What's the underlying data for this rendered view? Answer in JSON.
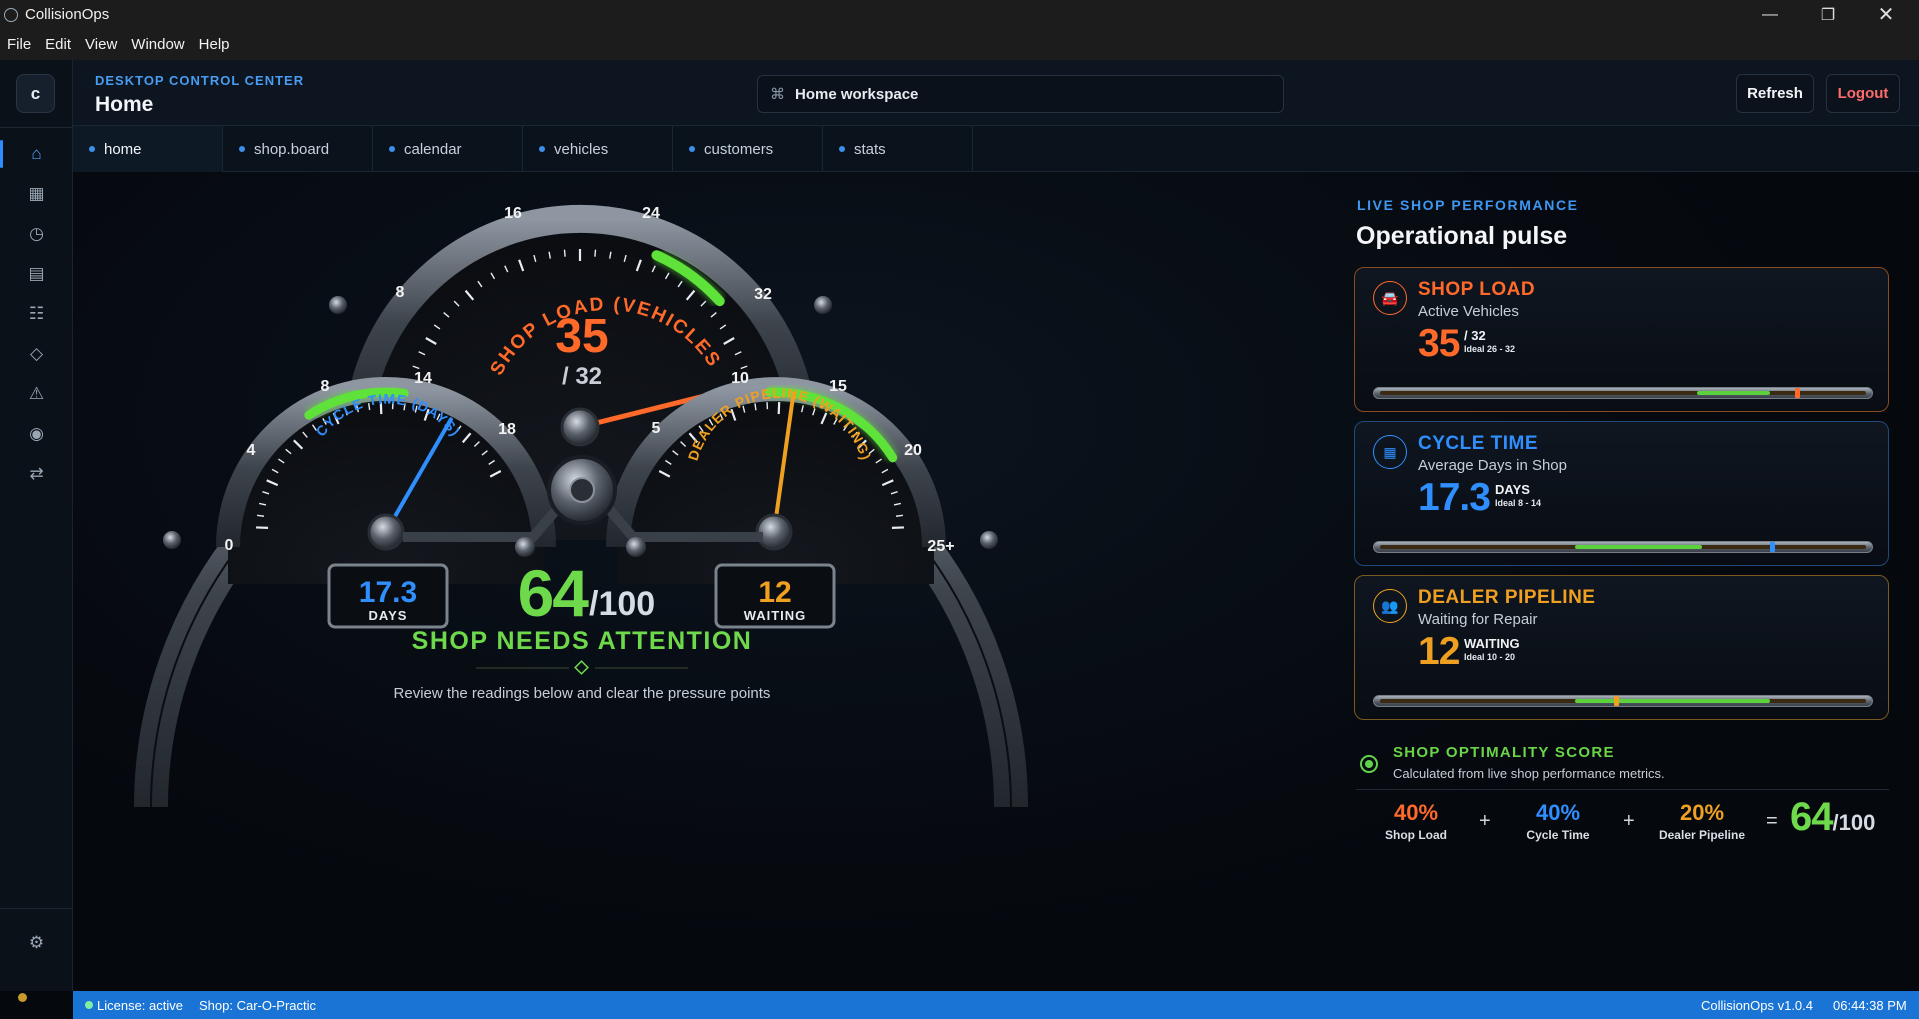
{
  "window": {
    "title": "CollisionOps",
    "controls": {
      "minimize": "—",
      "maximize": "❐",
      "close": "✕"
    }
  },
  "menu": [
    "File",
    "Edit",
    "View",
    "Window",
    "Help"
  ],
  "sidebar": {
    "logo": "c",
    "icons": [
      "home-icon",
      "grid-icon",
      "clock-icon",
      "list-icon",
      "menu-icon",
      "diamond-icon",
      "warning-icon",
      "target-icon",
      "swap-icon"
    ],
    "settings_icon": "gear-icon"
  },
  "header": {
    "eyebrow": "DESKTOP CONTROL CENTER",
    "title": "Home",
    "search_icon": "⌘",
    "search": "Home workspace",
    "refresh": "Refresh",
    "logout": "Logout"
  },
  "tabs": [
    {
      "label": "home",
      "active": true
    },
    {
      "label": "shop.board"
    },
    {
      "label": "calendar"
    },
    {
      "label": "vehicles"
    },
    {
      "label": "customers"
    },
    {
      "label": "stats"
    }
  ],
  "dashboard": {
    "shop_load_gauge": {
      "label": "SHOP LOAD (VEHICLES)",
      "value": "35",
      "capacity": "/ 32",
      "ticks": [
        "8",
        "16",
        "24",
        "32"
      ],
      "value_num": 35,
      "max": 40
    },
    "cycle_gauge": {
      "label": "CYCLE TIME (DAYS)",
      "ticks": [
        "0",
        "4",
        "8",
        "14",
        "18"
      ],
      "readout": "17.3",
      "readout_unit": "DAYS",
      "value_num": 17.3,
      "max": 22
    },
    "pipeline_gauge": {
      "label": "DEALER PIPELINE (WAITING)",
      "ticks": [
        "5",
        "10",
        "15",
        "20",
        "25+"
      ],
      "readout": "12",
      "readout_unit": "WAITING",
      "value_num": 12,
      "max": 25
    },
    "score": "64",
    "score_of": "/100",
    "status": "SHOP NEEDS ATTENTION",
    "hint": "Review the readings below and clear the pressure points"
  },
  "panel": {
    "eyebrow": "LIVE SHOP PERFORMANCE",
    "title": "Operational pulse",
    "cards": [
      {
        "key": "load",
        "title": "SHOP LOAD",
        "sub": "Active Vehicles",
        "value": "35",
        "unit": "/ 32",
        "ideal": "Ideal 26 - 32",
        "color": "#ff6a2a",
        "icon": "car-icon",
        "marker": 0.85,
        "ok_from": 0.65,
        "ok_to": 0.8
      },
      {
        "key": "cycle",
        "title": "CYCLE TIME",
        "sub": "Average Days in Shop",
        "value": "17.3",
        "unit": "DAYS",
        "ideal": "Ideal 8 - 14",
        "color": "#2f8fff",
        "icon": "calendar-icon",
        "marker": 0.8,
        "ok_from": 0.4,
        "ok_to": 0.66
      },
      {
        "key": "pipe",
        "title": "DEALER PIPELINE",
        "sub": "Waiting for Repair",
        "value": "12",
        "unit": "WAITING",
        "ideal": "Ideal 10 - 20",
        "color": "#f0a020",
        "icon": "people-icon",
        "marker": 0.48,
        "ok_from": 0.4,
        "ok_to": 0.8
      }
    ],
    "score": {
      "title": "SHOP OPTIMALITY SCORE",
      "sub": "Calculated from live shop performance metrics.",
      "parts": [
        {
          "pct": "40%",
          "label": "Shop Load",
          "color": "#ff6a2a"
        },
        {
          "pct": "40%",
          "label": "Cycle Time",
          "color": "#2f8fff"
        },
        {
          "pct": "20%",
          "label": "Dealer Pipeline",
          "color": "#f0a020"
        }
      ],
      "plus": "+",
      "equals": "=",
      "total": "64",
      "total_of": "/100"
    }
  },
  "status": {
    "license": "License: active",
    "shop": "Shop: Car-O-Practic",
    "version": "CollisionOps v1.0.4",
    "time": "06:44:38 PM"
  }
}
